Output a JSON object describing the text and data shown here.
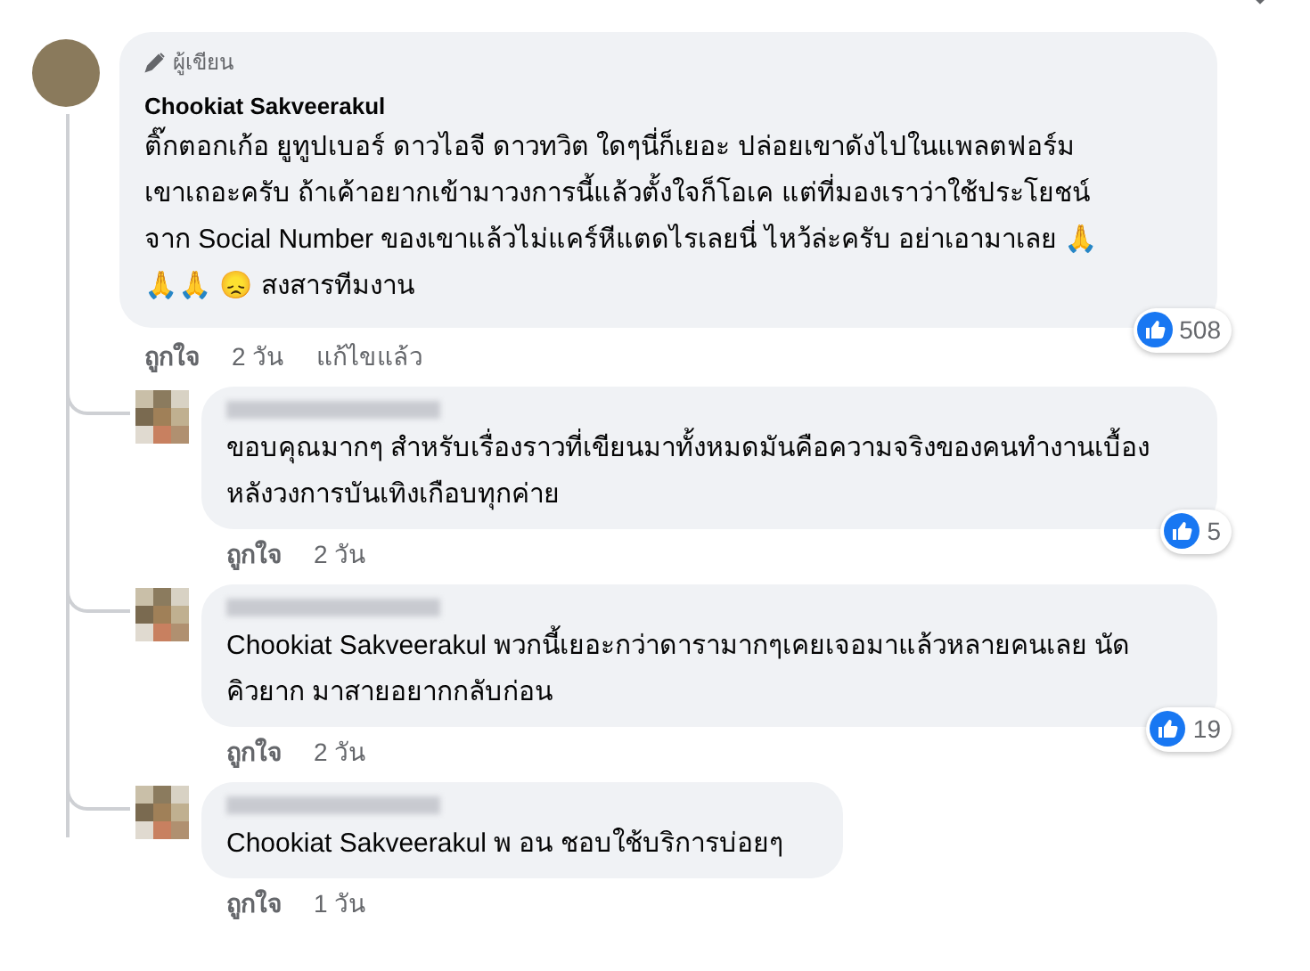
{
  "comment": {
    "badge": "ผู้เขียน",
    "author": "Chookiat Sakveerakul",
    "text": "ติ๊กตอกเก้อ ยูทูปเบอร์ ดาวไอจี ดาวทวิต ใดๆนี่ก็เยอะ ปล่อยเขาดังไปในแพลตฟอร์มเขาเถอะครับ ถ้าเค้าอยากเข้ามาวงการนี้แล้วตั้งใจก็โอเค แต่ที่มองเราว่าใช้ประโยชน์จาก Social Number ของเขาแล้วไม่แคร์หีแตดไรเลยนี่ ไหว้ล่ะครับ อย่าเอามาเลย 🙏🙏🙏 😞 สงสารทีมงาน",
    "reactions": "508",
    "like": "ถูกใจ",
    "time": "2 วัน",
    "edited": "แก้ไขแล้ว"
  },
  "replies": [
    {
      "text": "ขอบคุณมากๆ สำหรับเรื่องราวที่เขียนมาทั้งหมดมันคือความจริงของคนทำงานเบื้องหลังวงการบันเทิงเกือบทุกค่าย",
      "reactions": "5",
      "like": "ถูกใจ",
      "time": "2 วัน"
    },
    {
      "text": "Chookiat Sakveerakul พวกนี้เยอะกว่าดารามากๆเคยเจอมาแล้วหลายคนเลย นัดคิวยาก มาสายอยากกลับก่อน",
      "reactions": "19",
      "like": "ถูกใจ",
      "time": "2 วัน"
    },
    {
      "text": "Chookiat Sakveerakul พ อน ชอบใช้บริการบ่อยๆ",
      "like": "ถูกใจ",
      "time": "1 วัน"
    }
  ]
}
